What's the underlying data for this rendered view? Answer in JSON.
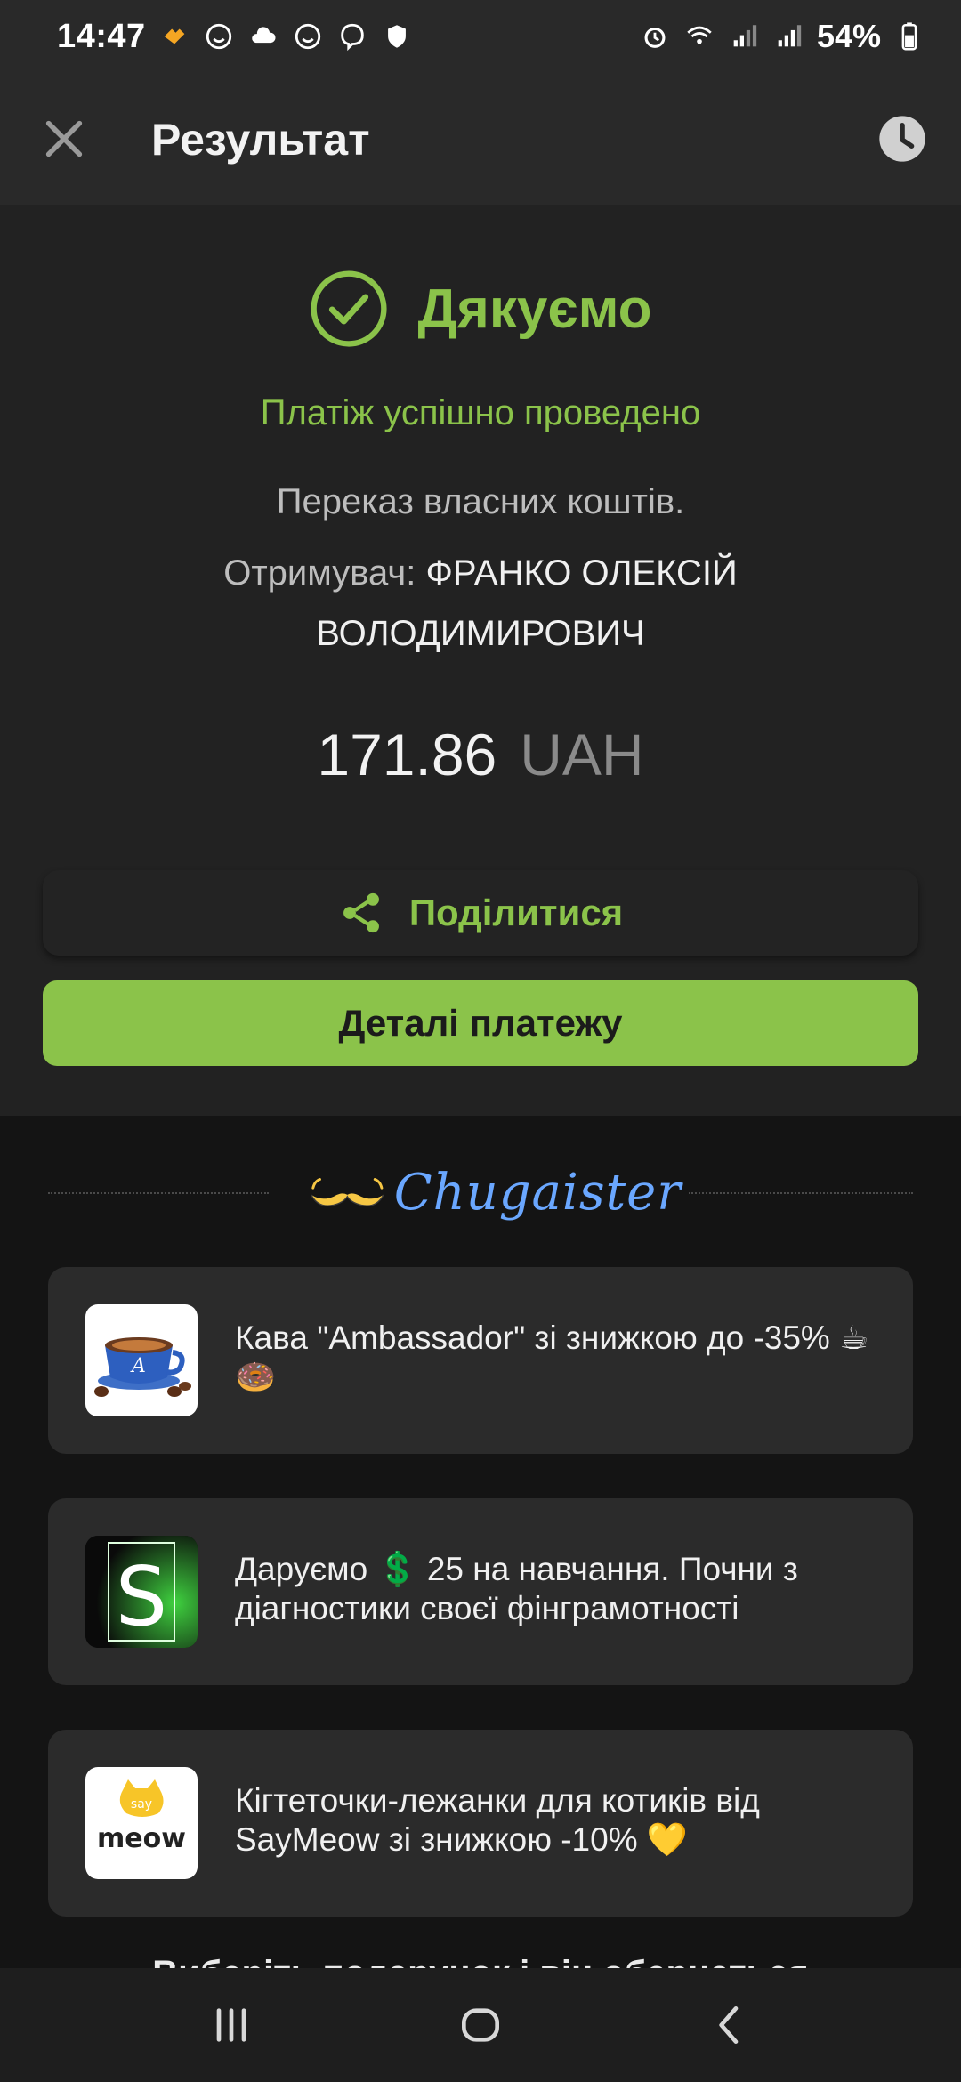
{
  "status_bar": {
    "time": "14:47",
    "battery": "54%",
    "icons": [
      "heart-badge-icon",
      "emoji-icon",
      "cloud-icon",
      "emoji-icon",
      "viber-icon",
      "shield-icon",
      "alarm-icon",
      "wifi-icon",
      "signal-icon",
      "signal-icon",
      "battery-icon"
    ]
  },
  "header": {
    "title": "Результат",
    "close_icon": "close-icon",
    "history_icon": "clock-icon"
  },
  "result": {
    "thanks": "Дякуємо",
    "success": "Платіж успішно проведено",
    "transfer": "Переказ власних коштів.",
    "recipient_label": "Отримувач: ",
    "recipient_name": "ФРАНКО ОЛЕКСІЙ ВОЛОДИМИРОВИЧ",
    "amount": "171.86",
    "currency": "UAH",
    "share_label": "Поділитися",
    "details_label": "Деталі платежу"
  },
  "brand": {
    "name": "Chugaister"
  },
  "offers": [
    {
      "text": "Кава \"Ambassador\" зі знижкою до -35% ☕🍩",
      "thumb": "coffee-cup"
    },
    {
      "text": "Даруємо 💲 25 на навчання. Почни з діагностики своєї фінграмотності",
      "thumb": "s-logo"
    },
    {
      "text": "Кігтеточки-лежанки для котиків від SayMeow зі знижкою -10% 💛",
      "thumb": "saymeow-logo"
    }
  ],
  "cut_text": "Виберіть подарунок і він обернеться",
  "colors": {
    "accent": "#8bc34a",
    "header_bg": "#292929",
    "panel_bg": "#222222",
    "page_bg": "#141414",
    "brand_blue": "#6aa7ff",
    "mustache": "#f6c744"
  }
}
